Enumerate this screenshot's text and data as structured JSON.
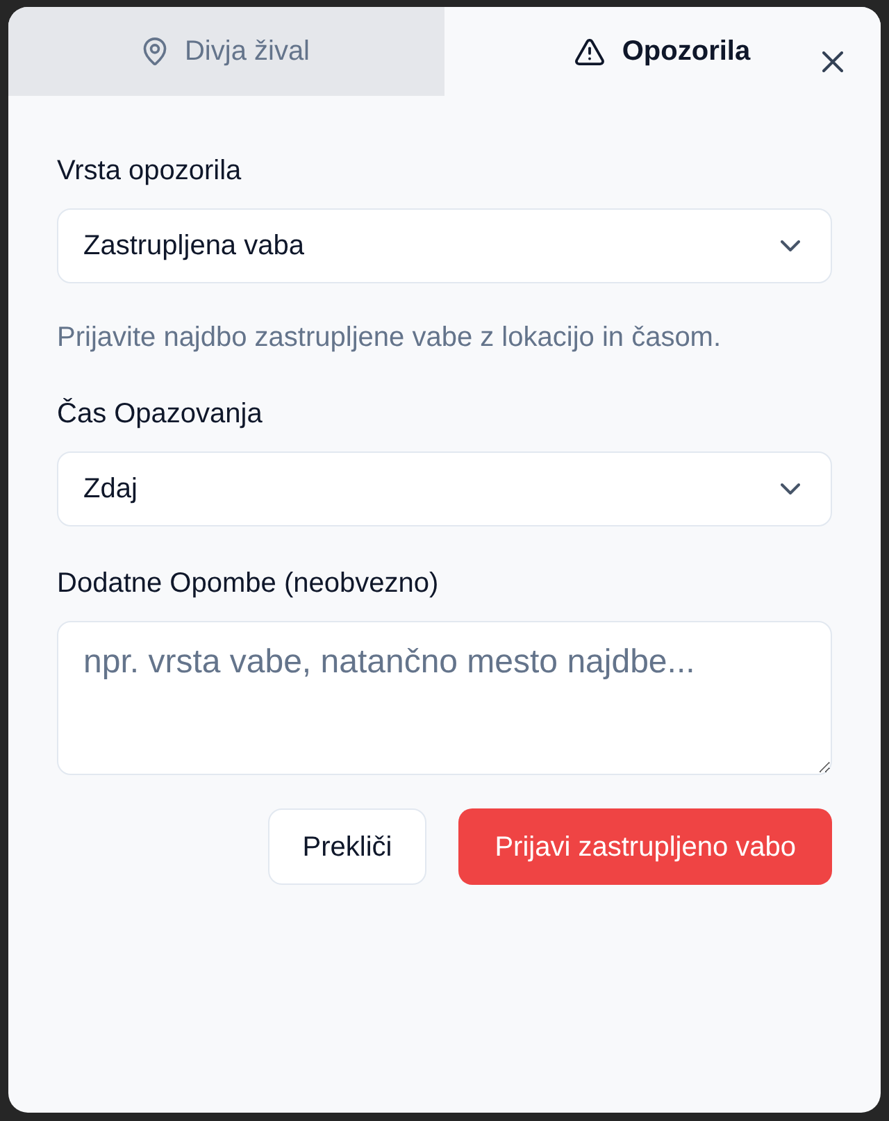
{
  "tabs": [
    {
      "label": "Divja žival",
      "selected": false
    },
    {
      "label": "Opozorila",
      "selected": true
    }
  ],
  "form": {
    "fields": [
      {
        "kind": "select",
        "label": "Vrsta opozorila",
        "value": "Zastrupljena vaba",
        "hint": "Prijavite najdbo zastrupljene vabe z lokacijo in časom."
      },
      {
        "kind": "select",
        "label": "Čas Opazovanja",
        "value": "Zdaj"
      },
      {
        "kind": "textarea",
        "label": "Dodatne Opombe (neobvezno)",
        "placeholder": "npr. vrsta vabe, natančno mesto najdbe..."
      }
    ]
  },
  "buttons": [
    {
      "label": "Prekliči",
      "kind": "secondary"
    },
    {
      "label": "Prijavi zastrupljeno vabo",
      "kind": "primary"
    }
  ]
}
